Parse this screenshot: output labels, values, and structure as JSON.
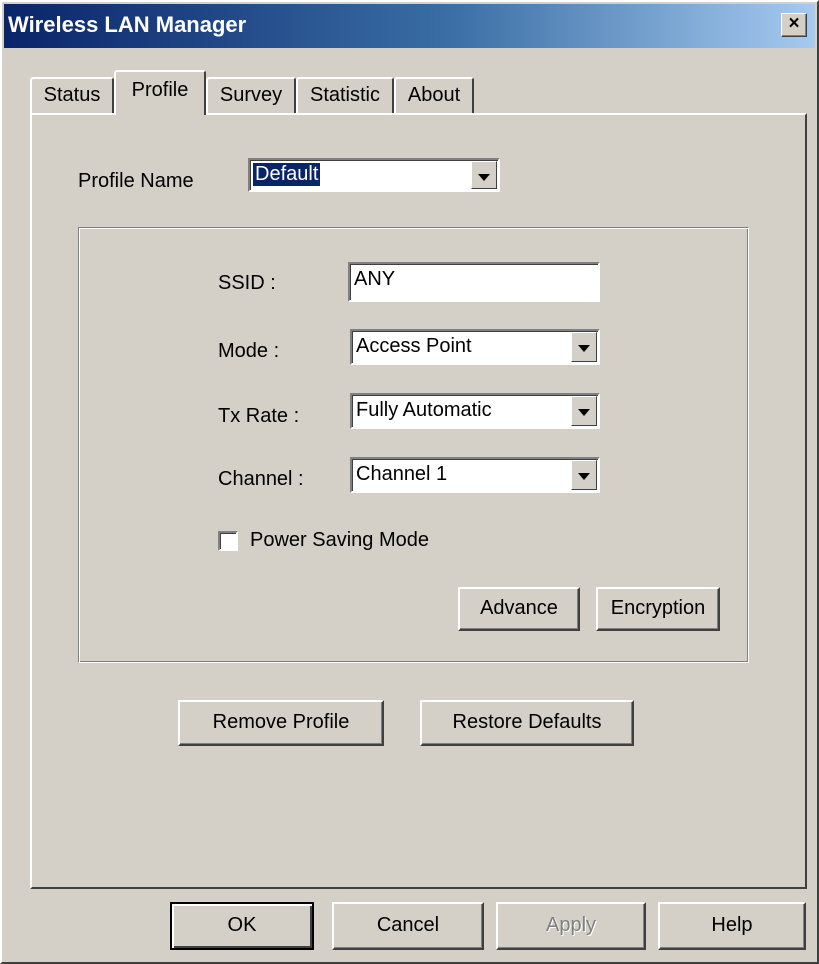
{
  "window": {
    "title": "Wireless LAN Manager",
    "close_glyph": "×"
  },
  "tabs": [
    {
      "label": "Status",
      "active": false
    },
    {
      "label": "Profile",
      "active": true
    },
    {
      "label": "Survey",
      "active": false
    },
    {
      "label": "Statistic",
      "active": false
    },
    {
      "label": "About",
      "active": false
    }
  ],
  "profile": {
    "name_label": "Profile Name",
    "name_value": "Default",
    "ssid_label": "SSID :",
    "ssid_value": "ANY",
    "mode_label": "Mode :",
    "mode_value": "Access Point",
    "tx_rate_label": "Tx Rate :",
    "tx_rate_value": "Fully Automatic",
    "channel_label": "Channel :",
    "channel_value": "Channel 1",
    "power_saving_label": "Power Saving Mode",
    "power_saving_checked": false,
    "advance_label": "Advance",
    "encryption_label": "Encryption",
    "remove_label": "Remove Profile",
    "restore_label": "Restore Defaults"
  },
  "footer": {
    "ok_label": "OK",
    "cancel_label": "Cancel",
    "apply_label": "Apply",
    "help_label": "Help"
  },
  "colors": {
    "title_gradient_start": "#0a246a",
    "title_gradient_end": "#a6caf0",
    "face": "#d4d0c8",
    "selection": "#0a246a"
  }
}
